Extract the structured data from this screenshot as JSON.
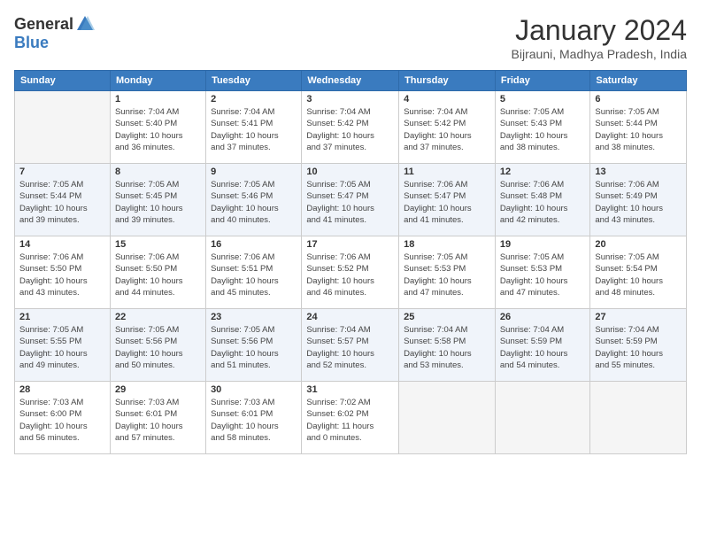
{
  "header": {
    "logo_general": "General",
    "logo_blue": "Blue",
    "month_title": "January 2024",
    "location": "Bijrauni, Madhya Pradesh, India"
  },
  "days_of_week": [
    "Sunday",
    "Monday",
    "Tuesday",
    "Wednesday",
    "Thursday",
    "Friday",
    "Saturday"
  ],
  "weeks": [
    [
      {
        "num": "",
        "info": ""
      },
      {
        "num": "1",
        "info": "Sunrise: 7:04 AM\nSunset: 5:40 PM\nDaylight: 10 hours\nand 36 minutes."
      },
      {
        "num": "2",
        "info": "Sunrise: 7:04 AM\nSunset: 5:41 PM\nDaylight: 10 hours\nand 37 minutes."
      },
      {
        "num": "3",
        "info": "Sunrise: 7:04 AM\nSunset: 5:42 PM\nDaylight: 10 hours\nand 37 minutes."
      },
      {
        "num": "4",
        "info": "Sunrise: 7:04 AM\nSunset: 5:42 PM\nDaylight: 10 hours\nand 37 minutes."
      },
      {
        "num": "5",
        "info": "Sunrise: 7:05 AM\nSunset: 5:43 PM\nDaylight: 10 hours\nand 38 minutes."
      },
      {
        "num": "6",
        "info": "Sunrise: 7:05 AM\nSunset: 5:44 PM\nDaylight: 10 hours\nand 38 minutes."
      }
    ],
    [
      {
        "num": "7",
        "info": "Sunrise: 7:05 AM\nSunset: 5:44 PM\nDaylight: 10 hours\nand 39 minutes."
      },
      {
        "num": "8",
        "info": "Sunrise: 7:05 AM\nSunset: 5:45 PM\nDaylight: 10 hours\nand 39 minutes."
      },
      {
        "num": "9",
        "info": "Sunrise: 7:05 AM\nSunset: 5:46 PM\nDaylight: 10 hours\nand 40 minutes."
      },
      {
        "num": "10",
        "info": "Sunrise: 7:05 AM\nSunset: 5:47 PM\nDaylight: 10 hours\nand 41 minutes."
      },
      {
        "num": "11",
        "info": "Sunrise: 7:06 AM\nSunset: 5:47 PM\nDaylight: 10 hours\nand 41 minutes."
      },
      {
        "num": "12",
        "info": "Sunrise: 7:06 AM\nSunset: 5:48 PM\nDaylight: 10 hours\nand 42 minutes."
      },
      {
        "num": "13",
        "info": "Sunrise: 7:06 AM\nSunset: 5:49 PM\nDaylight: 10 hours\nand 43 minutes."
      }
    ],
    [
      {
        "num": "14",
        "info": "Sunrise: 7:06 AM\nSunset: 5:50 PM\nDaylight: 10 hours\nand 43 minutes."
      },
      {
        "num": "15",
        "info": "Sunrise: 7:06 AM\nSunset: 5:50 PM\nDaylight: 10 hours\nand 44 minutes."
      },
      {
        "num": "16",
        "info": "Sunrise: 7:06 AM\nSunset: 5:51 PM\nDaylight: 10 hours\nand 45 minutes."
      },
      {
        "num": "17",
        "info": "Sunrise: 7:06 AM\nSunset: 5:52 PM\nDaylight: 10 hours\nand 46 minutes."
      },
      {
        "num": "18",
        "info": "Sunrise: 7:05 AM\nSunset: 5:53 PM\nDaylight: 10 hours\nand 47 minutes."
      },
      {
        "num": "19",
        "info": "Sunrise: 7:05 AM\nSunset: 5:53 PM\nDaylight: 10 hours\nand 47 minutes."
      },
      {
        "num": "20",
        "info": "Sunrise: 7:05 AM\nSunset: 5:54 PM\nDaylight: 10 hours\nand 48 minutes."
      }
    ],
    [
      {
        "num": "21",
        "info": "Sunrise: 7:05 AM\nSunset: 5:55 PM\nDaylight: 10 hours\nand 49 minutes."
      },
      {
        "num": "22",
        "info": "Sunrise: 7:05 AM\nSunset: 5:56 PM\nDaylight: 10 hours\nand 50 minutes."
      },
      {
        "num": "23",
        "info": "Sunrise: 7:05 AM\nSunset: 5:56 PM\nDaylight: 10 hours\nand 51 minutes."
      },
      {
        "num": "24",
        "info": "Sunrise: 7:04 AM\nSunset: 5:57 PM\nDaylight: 10 hours\nand 52 minutes."
      },
      {
        "num": "25",
        "info": "Sunrise: 7:04 AM\nSunset: 5:58 PM\nDaylight: 10 hours\nand 53 minutes."
      },
      {
        "num": "26",
        "info": "Sunrise: 7:04 AM\nSunset: 5:59 PM\nDaylight: 10 hours\nand 54 minutes."
      },
      {
        "num": "27",
        "info": "Sunrise: 7:04 AM\nSunset: 5:59 PM\nDaylight: 10 hours\nand 55 minutes."
      }
    ],
    [
      {
        "num": "28",
        "info": "Sunrise: 7:03 AM\nSunset: 6:00 PM\nDaylight: 10 hours\nand 56 minutes."
      },
      {
        "num": "29",
        "info": "Sunrise: 7:03 AM\nSunset: 6:01 PM\nDaylight: 10 hours\nand 57 minutes."
      },
      {
        "num": "30",
        "info": "Sunrise: 7:03 AM\nSunset: 6:01 PM\nDaylight: 10 hours\nand 58 minutes."
      },
      {
        "num": "31",
        "info": "Sunrise: 7:02 AM\nSunset: 6:02 PM\nDaylight: 11 hours\nand 0 minutes."
      },
      {
        "num": "",
        "info": ""
      },
      {
        "num": "",
        "info": ""
      },
      {
        "num": "",
        "info": ""
      }
    ]
  ]
}
